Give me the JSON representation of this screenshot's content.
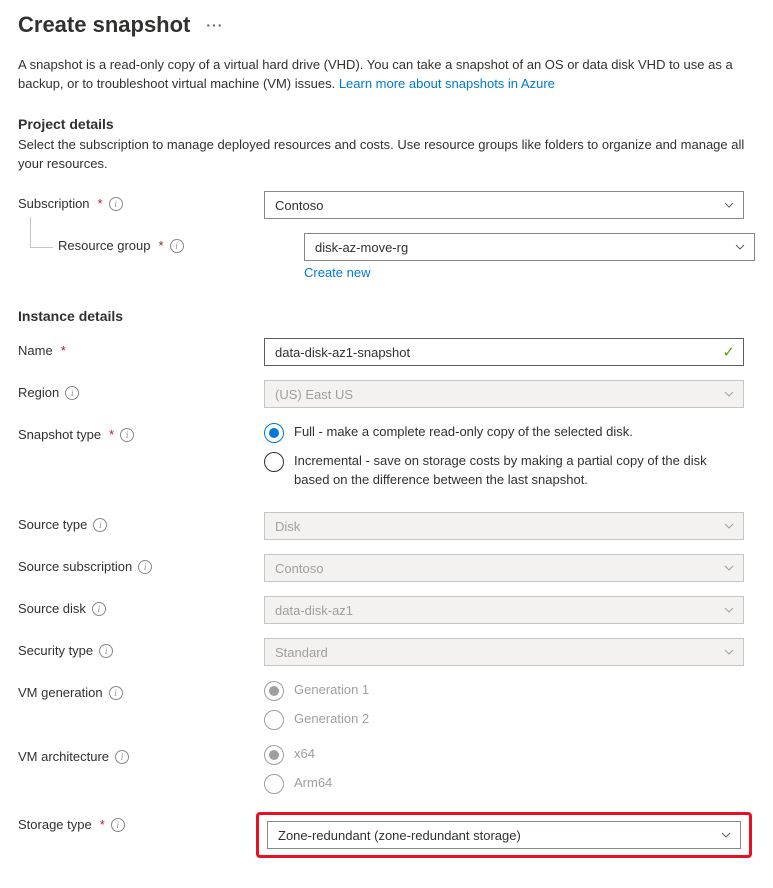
{
  "page": {
    "title": "Create snapshot",
    "intro_text": "A snapshot is a read-only copy of a virtual hard drive (VHD). You can take a snapshot of an OS or data disk VHD to use as a backup, or to troubleshoot virtual machine (VM) issues. ",
    "intro_link": "Learn more about snapshots in Azure"
  },
  "project_details": {
    "heading": "Project details",
    "desc": "Select the subscription to manage deployed resources and costs. Use resource groups like folders to organize and manage all your resources.",
    "subscription": {
      "label": "Subscription",
      "value": "Contoso"
    },
    "resource_group": {
      "label": "Resource group",
      "value": "disk-az-move-rg",
      "create_new": "Create new"
    }
  },
  "instance_details": {
    "heading": "Instance details",
    "name": {
      "label": "Name",
      "value": "data-disk-az1-snapshot"
    },
    "region": {
      "label": "Region",
      "value": "(US) East US"
    },
    "snapshot_type": {
      "label": "Snapshot type",
      "options": [
        {
          "label": "Full - make a complete read-only copy of the selected disk.",
          "selected": true
        },
        {
          "label": "Incremental - save on storage costs by making a partial copy of the disk based on the difference between the last snapshot.",
          "selected": false
        }
      ]
    },
    "source_type": {
      "label": "Source type",
      "value": "Disk"
    },
    "source_subscription": {
      "label": "Source subscription",
      "value": "Contoso"
    },
    "source_disk": {
      "label": "Source disk",
      "value": "data-disk-az1"
    },
    "security_type": {
      "label": "Security type",
      "value": "Standard"
    },
    "vm_generation": {
      "label": "VM generation",
      "options": [
        {
          "label": "Generation 1",
          "selected": true
        },
        {
          "label": "Generation 2",
          "selected": false
        }
      ]
    },
    "vm_architecture": {
      "label": "VM architecture",
      "options": [
        {
          "label": "x64",
          "selected": true
        },
        {
          "label": "Arm64",
          "selected": false
        }
      ]
    },
    "storage_type": {
      "label": "Storage type",
      "value": "Zone-redundant (zone-redundant storage)"
    }
  }
}
